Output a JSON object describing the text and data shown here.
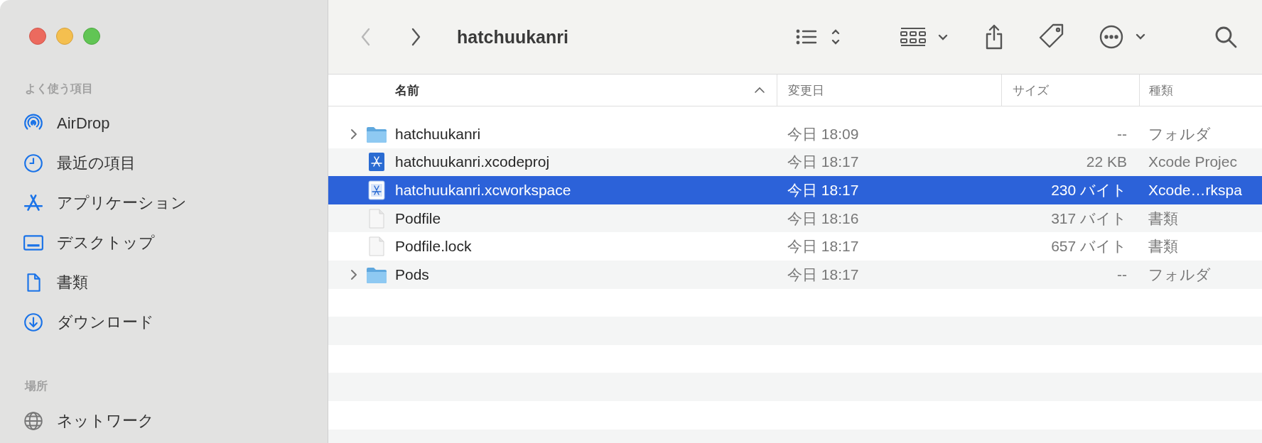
{
  "window": {
    "title": "hatchuukanri"
  },
  "sidebar": {
    "sections": [
      {
        "header": "よく使う項目",
        "items": [
          {
            "label": "AirDrop",
            "kind": "airdrop",
            "selected": false
          },
          {
            "label": "最近の項目",
            "kind": "recents",
            "selected": false
          },
          {
            "label": "アプリケーション",
            "kind": "applications",
            "selected": false
          },
          {
            "label": "デスクトップ",
            "kind": "desktop",
            "selected": false
          },
          {
            "label": "書類",
            "kind": "documents",
            "selected": false
          },
          {
            "label": "ダウンロード",
            "kind": "downloads",
            "selected": false
          }
        ]
      },
      {
        "header": "場所",
        "items": [
          {
            "label": "ネットワーク",
            "kind": "network",
            "selected": false
          }
        ]
      }
    ]
  },
  "toolbar": {
    "back_enabled": false,
    "forward_enabled": true
  },
  "table": {
    "columns": [
      {
        "label": "名前",
        "sorted": true
      },
      {
        "label": "変更日",
        "sorted": false
      },
      {
        "label": "サイズ",
        "sorted": false
      },
      {
        "label": "種類",
        "sorted": false
      }
    ],
    "rows": [
      {
        "name": "hatchuukanri",
        "kind": "folder",
        "expandable": true,
        "selected": false,
        "date": "今日 18:09",
        "size": "--",
        "type": "フォルダ"
      },
      {
        "name": "hatchuukanri.xcodeproj",
        "kind": "xcodeproj",
        "expandable": false,
        "selected": false,
        "date": "今日 18:17",
        "size": "22 KB",
        "type": "Xcode Projec"
      },
      {
        "name": "hatchuukanri.xcworkspace",
        "kind": "xcworkspace",
        "expandable": false,
        "selected": true,
        "date": "今日 18:17",
        "size": "230 バイト",
        "type": "Xcode…rkspa"
      },
      {
        "name": "Podfile",
        "kind": "document",
        "expandable": false,
        "selected": false,
        "date": "今日 18:16",
        "size": "317 バイト",
        "type": "書類"
      },
      {
        "name": "Podfile.lock",
        "kind": "document",
        "expandable": false,
        "selected": false,
        "date": "今日 18:17",
        "size": "657 バイト",
        "type": "書類"
      },
      {
        "name": "Pods",
        "kind": "folder",
        "expandable": true,
        "selected": false,
        "date": "今日 18:17",
        "size": "--",
        "type": "フォルダ"
      }
    ]
  }
}
